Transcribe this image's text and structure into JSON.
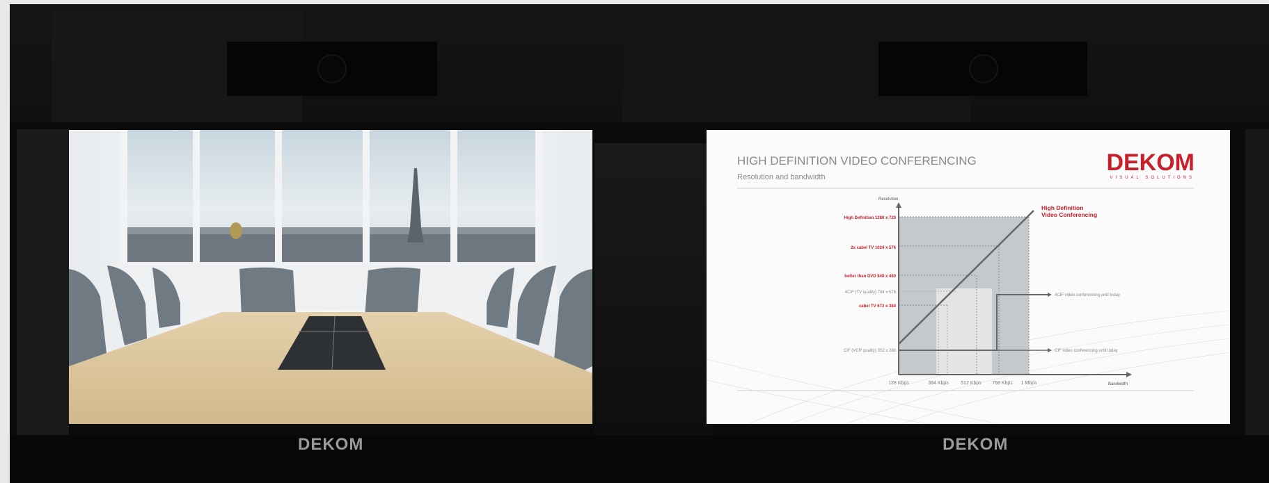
{
  "slide": {
    "title": "HIGH DEFINITION VIDEO CONFERENCING",
    "subtitle": "Resolution and bandwidth",
    "logo_text": "DEKOM",
    "logo_tagline": "VISUAL SOLUTIONS",
    "y_axis_label": "Resolution",
    "x_axis_label": "Bandwidth",
    "resolutions": [
      "High Definition 1280 x 720",
      "2x cabel TV 1024 x 576",
      "better than DVD 848 x 480",
      "4CIF (TV quality) 704 x 576",
      "cabel TV 672 x 384",
      "CIF (VCR quality) 352 x 288"
    ],
    "bandwidths": [
      "128 Kbps",
      "384 Kbps",
      "512 Kbps",
      "768 Kbps",
      "1 Mbps"
    ],
    "hd_label_line1": "High Definition",
    "hd_label_line2": "Video Conferencing",
    "annotation_4cif": "4CIF video conferencing until today",
    "annotation_cif": "CIF video conferencing until today"
  },
  "under_screen_brand_left": "DEKOM",
  "under_screen_brand_right": "DEKOM",
  "colors": {
    "accent_red": "#c8202a",
    "frame": "#0b0b0c",
    "table": "#ddc7a0"
  }
}
